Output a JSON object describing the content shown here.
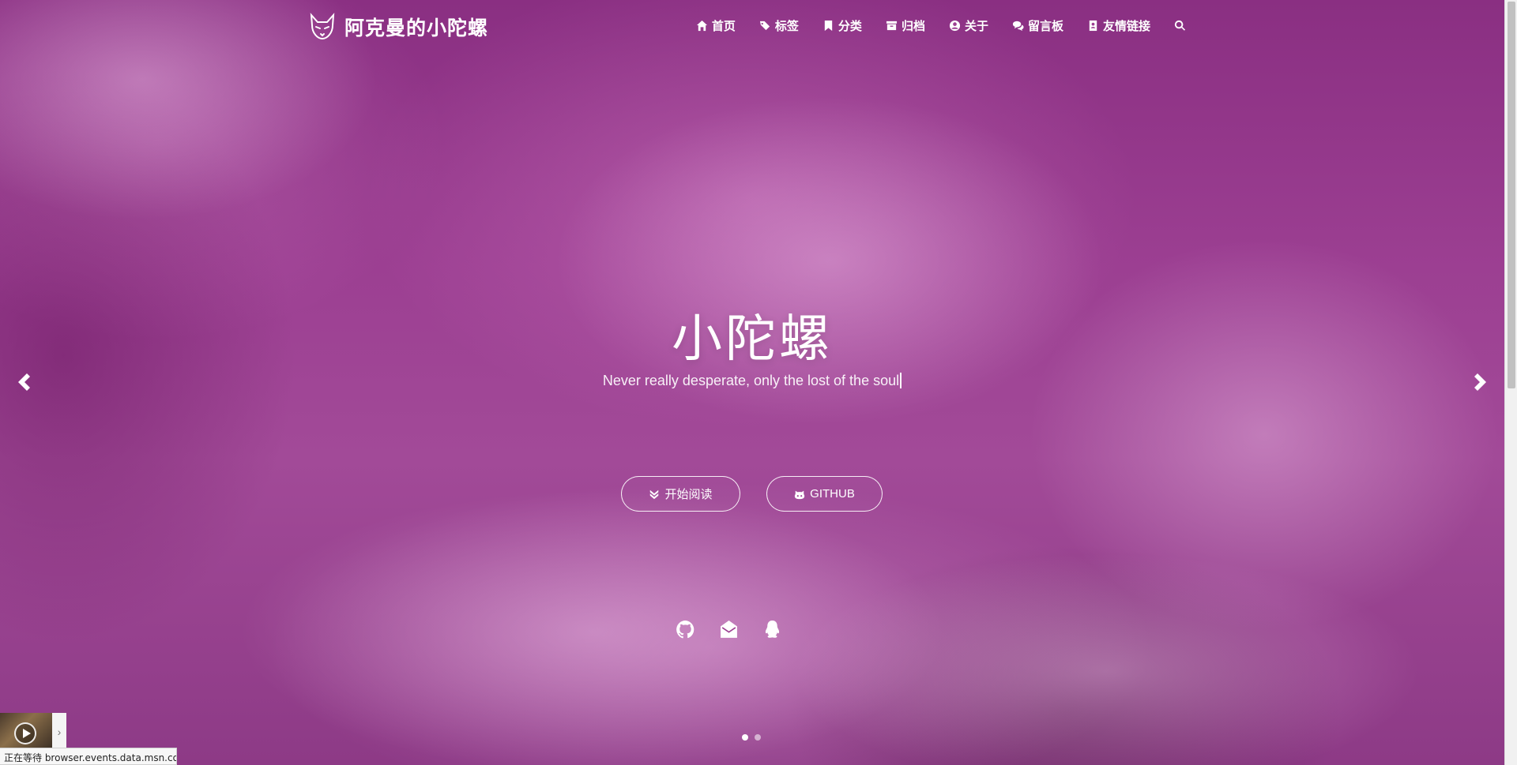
{
  "brand": {
    "name": "阿克曼的小陀螺",
    "logo": "fox-logo-icon"
  },
  "nav": {
    "items": [
      {
        "label": "首页",
        "icon": "home-icon"
      },
      {
        "label": "标签",
        "icon": "tags-icon"
      },
      {
        "label": "分类",
        "icon": "bookmark-icon"
      },
      {
        "label": "归档",
        "icon": "archive-icon"
      },
      {
        "label": "关于",
        "icon": "user-circle-icon"
      },
      {
        "label": "留言板",
        "icon": "comments-icon"
      },
      {
        "label": "友情链接",
        "icon": "address-book-icon"
      }
    ],
    "search_icon": "search-icon"
  },
  "hero": {
    "title": "小陀螺",
    "subtitle": "Never really desperate, only the lost of the soul",
    "buttons": {
      "read_label": "开始阅读",
      "read_icon": "angle-double-down-icon",
      "github_label": "GITHUB",
      "github_icon": "github-alt-icon"
    },
    "social": [
      "github-icon",
      "envelope-open-icon",
      "qq-icon"
    ],
    "carousel": {
      "slides": 2,
      "active": 1
    }
  },
  "status": {
    "text": "正在等待 browser.events.data.msn.co..."
  },
  "colors": {
    "accent": "#9c3f92",
    "text": "#ffffff"
  }
}
